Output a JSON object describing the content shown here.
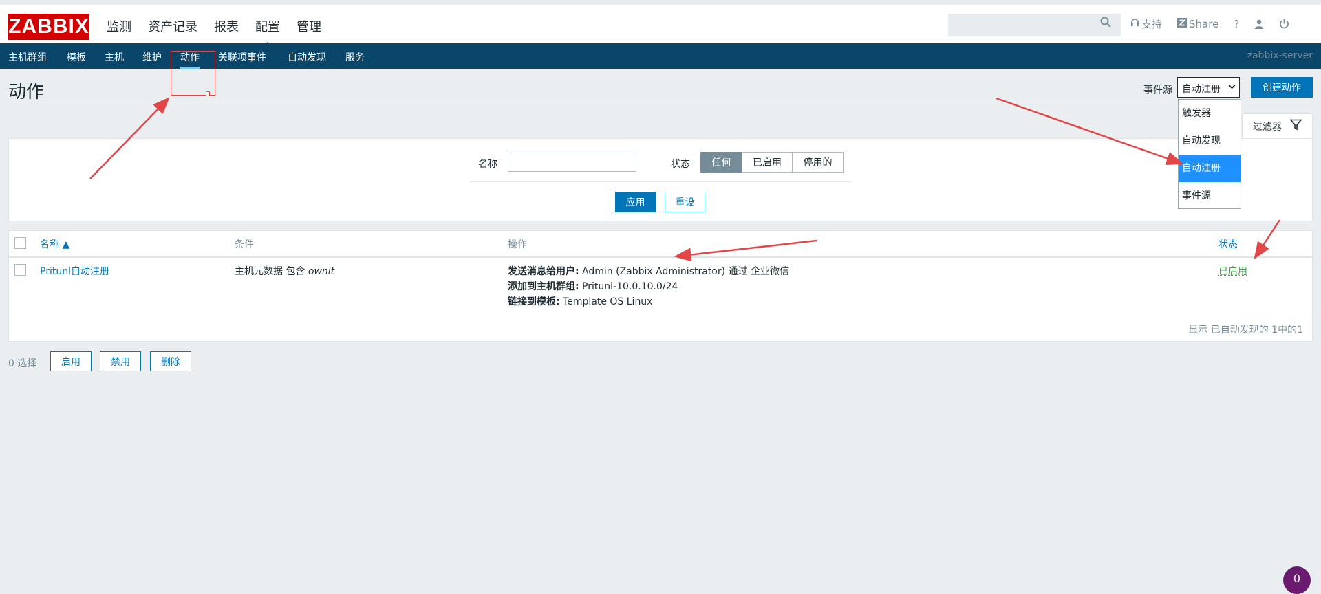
{
  "logo": "ZABBIX",
  "main_menu": [
    "监测",
    "资产记录",
    "报表",
    "配置",
    "管理"
  ],
  "top_links": {
    "support": "支持",
    "share": "Share",
    "help": "?"
  },
  "search": {
    "value": "",
    "placeholder": ""
  },
  "sub_menu": [
    "主机群组",
    "模板",
    "主机",
    "维护",
    "动作",
    "关联项事件",
    "自动发现",
    "服务"
  ],
  "server_name": "zabbix-server",
  "page_title": "动作",
  "event_source": {
    "label": "事件源",
    "selected": "自动注册",
    "options": [
      "触发器",
      "自动发现",
      "自动注册",
      "事件源"
    ]
  },
  "create_button": "创建动作",
  "filter": {
    "tab_label": "过滤器",
    "name_label": "名称",
    "name_value": "",
    "status_label": "状态",
    "status_options": [
      "任何",
      "已启用",
      "停用的"
    ],
    "apply": "应用",
    "reset": "重设"
  },
  "table": {
    "headers": {
      "name": "名称 ▲",
      "conditions": "条件",
      "operations": "操作",
      "status": "状态"
    },
    "rows": [
      {
        "name": "Pritunl自动注册",
        "condition_prefix": "主机元数据 包含 ",
        "condition_value": "ownit",
        "operations": [
          {
            "label": "发送消息给用户:",
            "text": " Admin (Zabbix Administrator) 通过 企业微信"
          },
          {
            "label": "添加到主机群组:",
            "text": " Pritunl-10.0.10.0/24"
          },
          {
            "label": "链接到模板:",
            "text": " Template OS Linux"
          }
        ],
        "status": "已启用"
      }
    ],
    "footer": "显示 已自动发现的 1中的1"
  },
  "bottom": {
    "selected_count": "0 选择",
    "enable": "启用",
    "disable": "禁用",
    "delete": "删除"
  },
  "avatar_letter": "0",
  "colors": {
    "brand": "#d40000",
    "nav": "#0a466a",
    "primary": "#0275b8",
    "enabled": "#429e47",
    "annotation": "#e24646"
  }
}
